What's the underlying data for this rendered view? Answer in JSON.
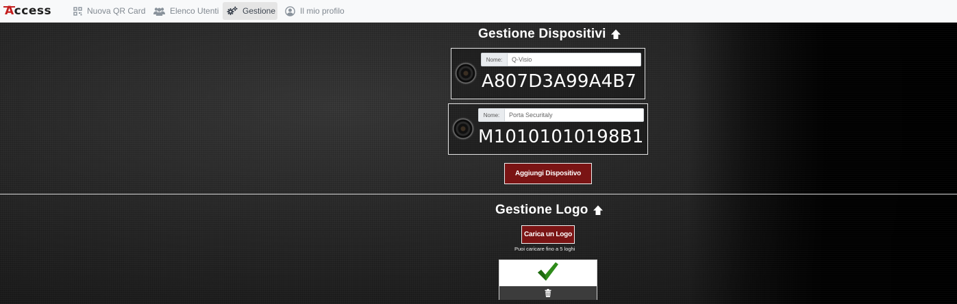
{
  "navbar": {
    "brand": {
      "first": "A",
      "rest": "ccess"
    },
    "items": [
      {
        "label": "Nuova QR Card",
        "icon": "qrcode-icon",
        "active": false
      },
      {
        "label": "Elenco Utenti",
        "icon": "users-icon",
        "active": false
      },
      {
        "label": "Gestione",
        "icon": "cogs-icon",
        "active": true
      },
      {
        "label": "Il mio profilo",
        "icon": "user-circle-icon",
        "active": false
      }
    ]
  },
  "devices_section": {
    "title": "Gestione Dispositivi",
    "title_icon": "arrow-up-icon",
    "devices": [
      {
        "name_label": "Nome:",
        "name_value": "Q-Visio",
        "device_id": "A807D3A99A4B7",
        "icon": "camera-icon"
      },
      {
        "name_label": "Nome:",
        "name_value": "Porta Securitaly",
        "device_id": "M10101010198B1",
        "icon": "camera-icon"
      }
    ],
    "add_button": "Aggiungi Dispositivo"
  },
  "logo_section": {
    "title": "Gestione Logo",
    "title_icon": "arrow-up-icon",
    "upload_button": "Carica un Logo",
    "hint": "Puoi caricare fino a 5 loghi",
    "logos": [
      {
        "image_icon": "checkmark-icon",
        "delete_icon": "trash-icon"
      }
    ]
  },
  "colors": {
    "accent_red": "#7a1414",
    "brand_red": "#c41e1e",
    "checkmark_green": "#2e8b1a",
    "navbar_bg": "#f8f9fa"
  }
}
